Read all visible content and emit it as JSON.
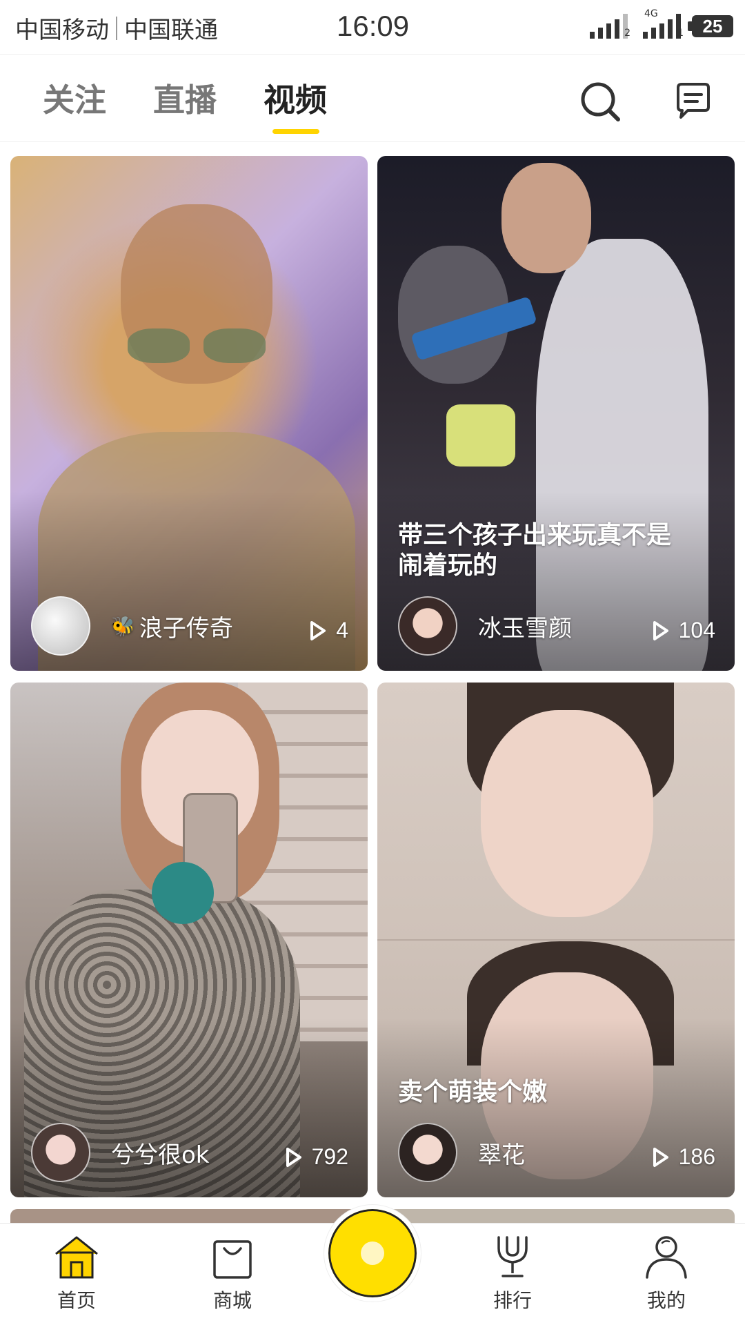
{
  "status_bar": {
    "carrier1": "中国移动",
    "carrier2": "中国联通",
    "time": "16:09",
    "sim1_tag": "2",
    "sim2_tag": "1",
    "network": "4G",
    "battery": "25"
  },
  "top_nav": {
    "tabs": [
      {
        "label": "关注",
        "active": false
      },
      {
        "label": "直播",
        "active": false
      },
      {
        "label": "视频",
        "active": true
      }
    ],
    "icons": [
      "search-icon",
      "message-icon"
    ],
    "accent_color": "#ffd400"
  },
  "feed": {
    "cards": [
      {
        "caption": "",
        "user": "浪子传奇",
        "plays": "4",
        "theme": "#c9b6d8"
      },
      {
        "caption": "带三个孩子出来玩真不是闹着玩的",
        "user": "冰玉雪颜",
        "plays": "104",
        "theme": "#3a3a48"
      },
      {
        "caption": "",
        "user": "兮兮很ok",
        "plays": "792",
        "theme": "#9d8f86"
      },
      {
        "caption": "卖个萌装个嫩",
        "user": "翠花",
        "plays": "186",
        "theme": "#e3d8d0"
      }
    ]
  },
  "bottom_nav": {
    "items": [
      {
        "label": "首页",
        "icon": "home-icon",
        "active": true
      },
      {
        "label": "商城",
        "icon": "shopping-bag-icon",
        "active": false
      },
      {
        "label": "排行",
        "icon": "trophy-icon",
        "active": false
      },
      {
        "label": "我的",
        "icon": "profile-icon",
        "active": false
      }
    ],
    "center_button_color": "#ffdf00"
  }
}
